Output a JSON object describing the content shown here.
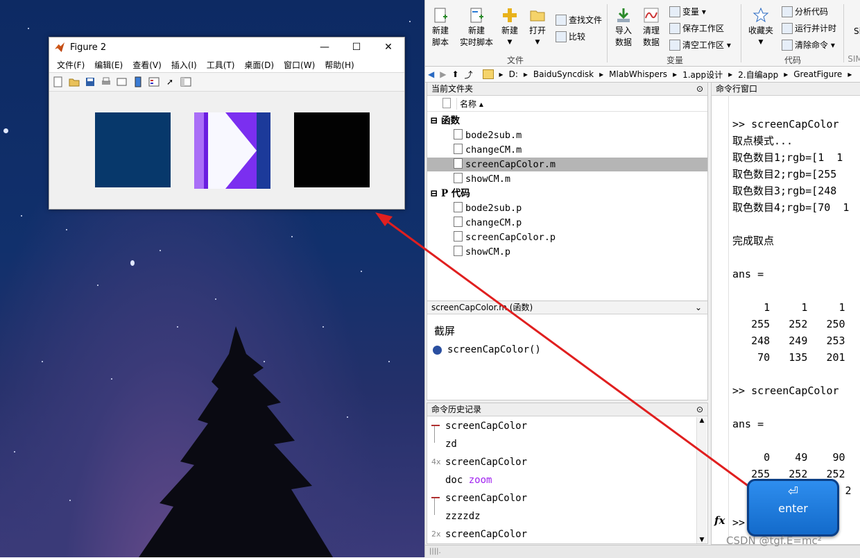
{
  "figure": {
    "title": "Figure 2",
    "menu": [
      "文件(F)",
      "编辑(E)",
      "查看(V)",
      "插入(I)",
      "工具(T)",
      "桌面(D)",
      "窗口(W)",
      "帮助(H)"
    ],
    "window_controls": {
      "minimize": "—",
      "maximize": "☐",
      "close": "✕"
    },
    "swatches": [
      "#07386b",
      "#7b2ff0",
      "#020202"
    ]
  },
  "ribbon": {
    "buttons": [
      {
        "label": "新建\n脚本"
      },
      {
        "label": "新建\n实时脚本"
      },
      {
        "label": "新建"
      },
      {
        "label": "打开"
      },
      {
        "label": "导入\n数据"
      },
      {
        "label": "清理\n数据"
      },
      {
        "label": "收藏夹"
      }
    ],
    "small": [
      "查找文件",
      "比较",
      "变量 ▾",
      "保存工作区",
      "清空工作区 ▾",
      "分析代码",
      "运行并计时",
      "清除命令 ▾"
    ],
    "groups": [
      "文件",
      "变量",
      "代码",
      "SIM"
    ],
    "cut": "Si"
  },
  "address": {
    "path": [
      "D:",
      "BaiduSyncdisk",
      "MlabWhispers",
      "1.app设计",
      "2.自编app",
      "GreatFigure"
    ]
  },
  "current_folder": {
    "title": "当前文件夹",
    "column": "名称 ▴",
    "groups": [
      {
        "label": "函数",
        "files": [
          "bode2sub.m",
          "changeCM.m",
          "screenCapColor.m",
          "showCM.m"
        ]
      },
      {
        "label": "P 代码",
        "files": [
          "bode2sub.p",
          "changeCM.p",
          "screenCapColor.p",
          "showCM.p"
        ]
      }
    ],
    "selected": "screenCapColor.m"
  },
  "details": {
    "header": "screenCapColor.m  (函数)",
    "description": "截屏",
    "signature": "screenCapColor()"
  },
  "history": {
    "title": "命令历史记录",
    "items": [
      {
        "badge": "",
        "cmd": "screenCapColor",
        "arg": ""
      },
      {
        "badge": "",
        "cmd": "zd",
        "arg": ""
      },
      {
        "badge": "4x",
        "cmd": "screenCapColor",
        "arg": ""
      },
      {
        "badge": "",
        "cmd": "doc",
        "arg": "zoom"
      },
      {
        "badge": "",
        "cmd": "screenCapColor",
        "arg": ""
      },
      {
        "badge": "",
        "cmd": "zzzzdz",
        "arg": ""
      },
      {
        "badge": "2x",
        "cmd": "screenCapColor",
        "arg": ""
      }
    ]
  },
  "command_window": {
    "title": "命令行窗口",
    "lines": [
      ">> screenCapColor",
      "取点模式...",
      "取色数目1;rgb=[1  1",
      "取色数目2;rgb=[255",
      "取色数目3;rgb=[248",
      "取色数目4;rgb=[70  1",
      "",
      "完成取点",
      "",
      "ans =",
      "",
      "     1     1     1",
      "   255   252   250",
      "   248   249   253",
      "    70   135   201",
      "",
      ">> screenCapColor",
      "",
      "ans =",
      "",
      "     0    49    90",
      "   255   252   252",
      "                  2"
    ],
    "prompt": ">>",
    "fx": "fx"
  },
  "overlay": {
    "enter_key": {
      "arrow": "⏎",
      "label": "enter"
    },
    "watermark": "CSDN @tgf.E=mc²"
  }
}
